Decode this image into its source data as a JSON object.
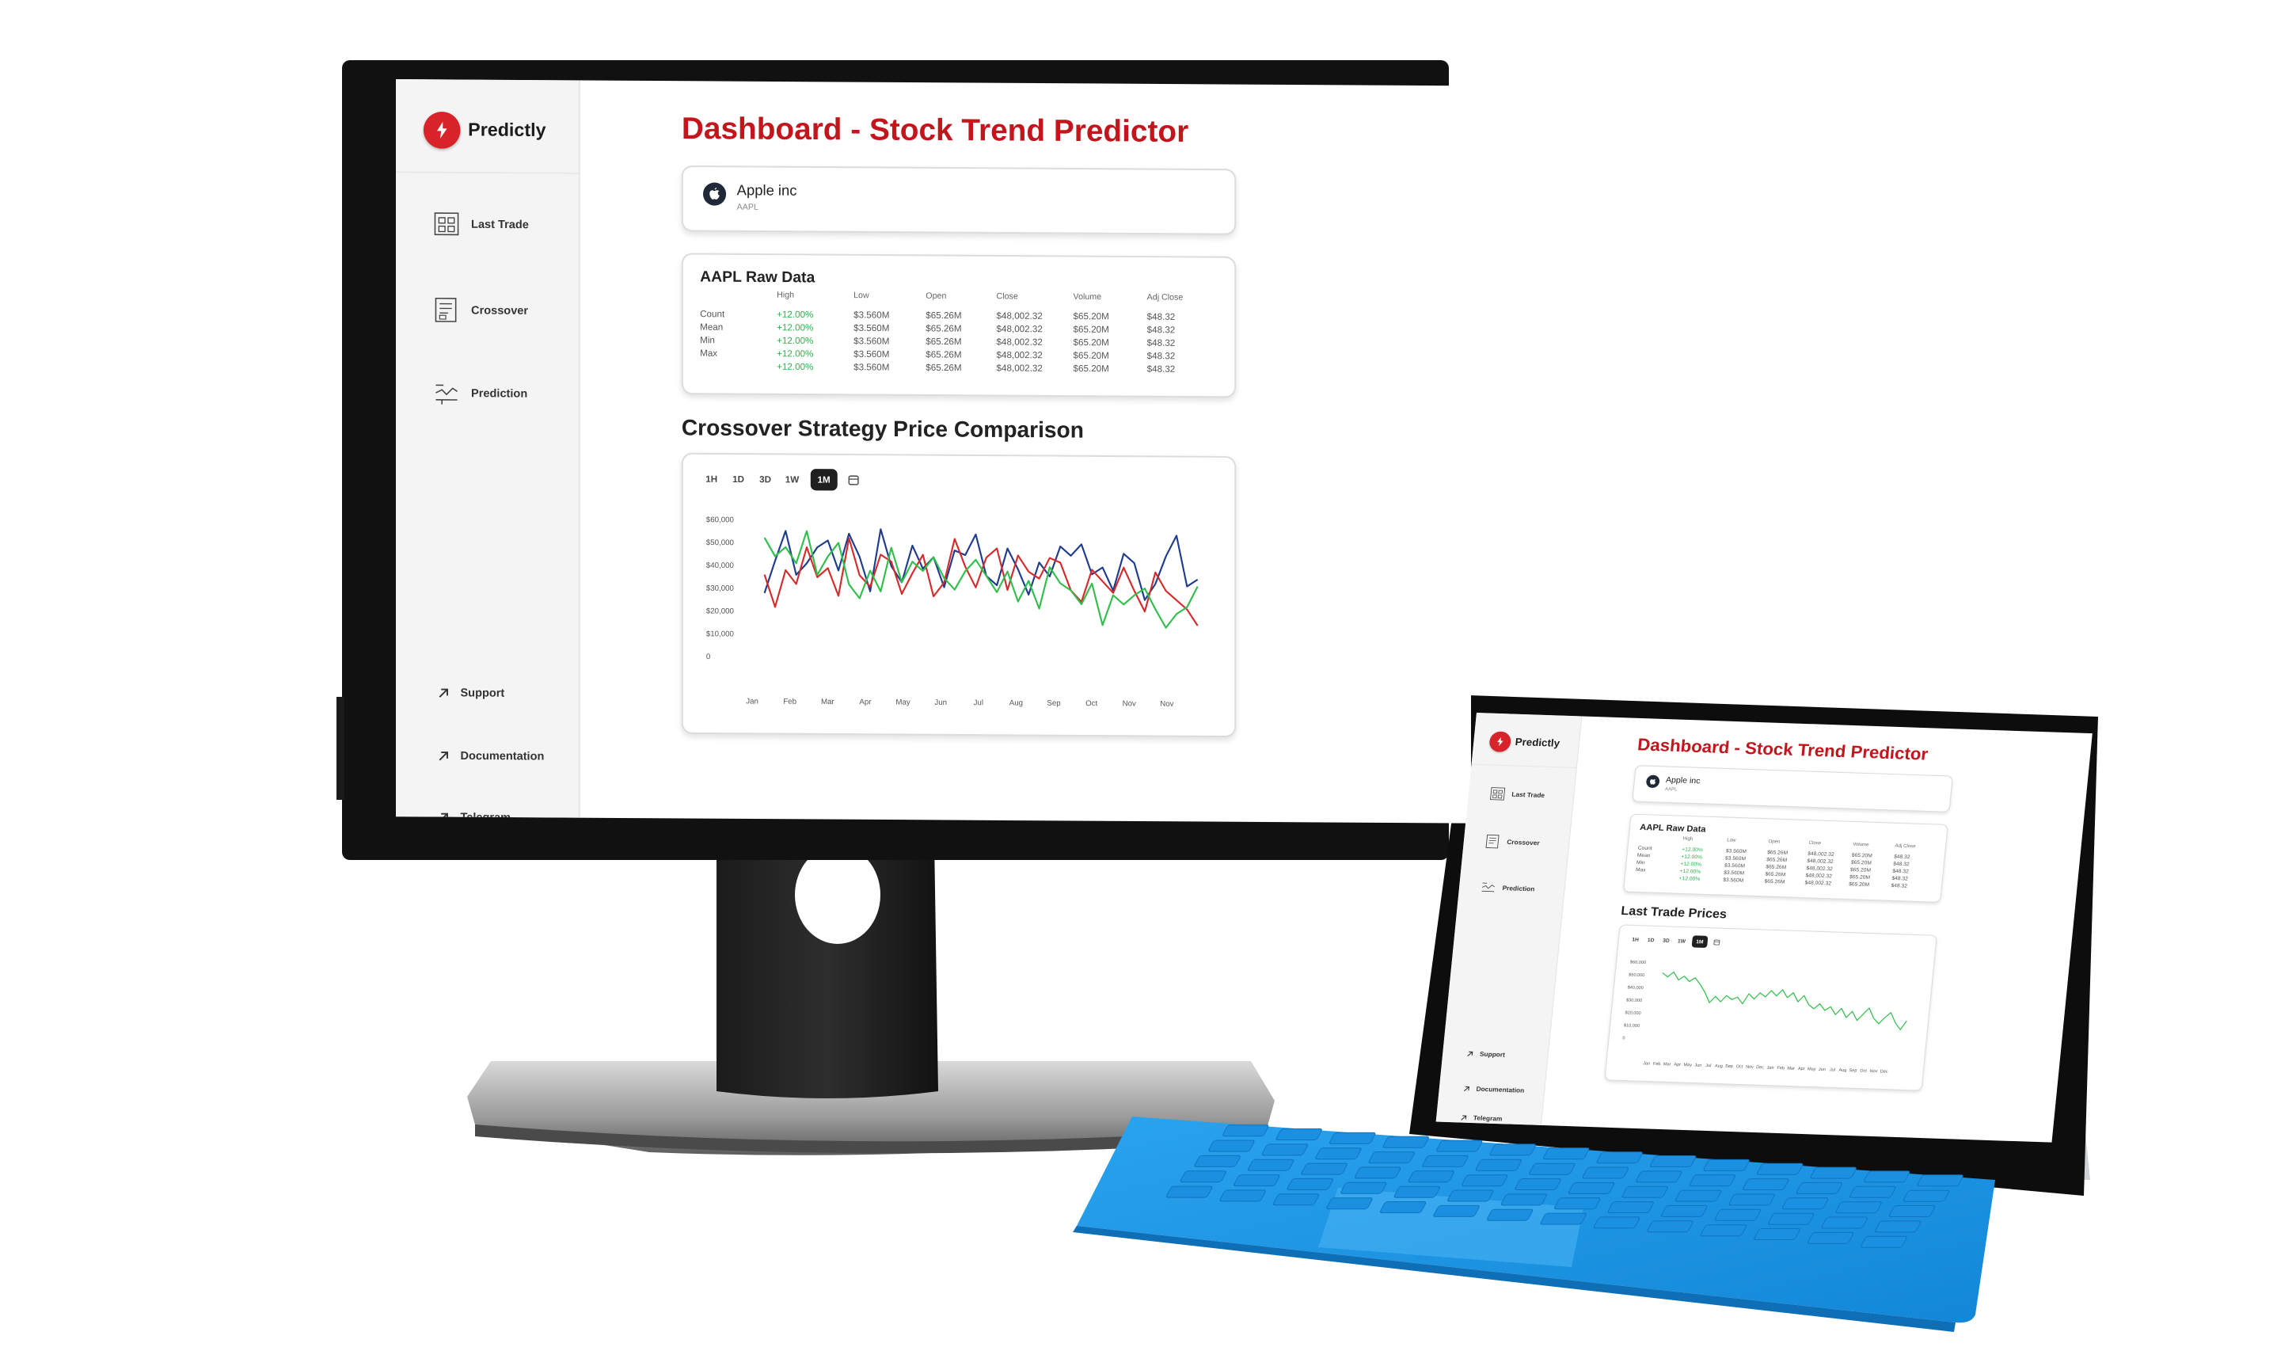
{
  "app": {
    "brand": "Predictly",
    "nav": [
      {
        "label": "Last Trade",
        "icon": "last-trade-icon"
      },
      {
        "label": "Crossover",
        "icon": "crossover-icon"
      },
      {
        "label": "Prediction",
        "icon": "prediction-icon"
      }
    ],
    "footer_links": [
      {
        "label": "Support",
        "icon": "arrow-up-right-icon"
      },
      {
        "label": "Documentation",
        "icon": "arrow-up-right-icon"
      },
      {
        "label": "Telegram",
        "icon": "arrow-up-right-icon"
      }
    ],
    "title": "Dashboard - Stock Trend Predictor",
    "company": {
      "name": "Apple inc",
      "ticker": "AAPL",
      "icon": "apple-icon"
    },
    "raw_data": {
      "title": "AAPL Raw Data",
      "columns": [
        "",
        "High",
        "Low",
        "Open",
        "Close",
        "Volume",
        "Adj Close"
      ],
      "rows": [
        [
          "Count",
          "+12.00%",
          "$3.560M",
          "$65.26M",
          "$48,002.32",
          "$65.20M",
          "$48.32"
        ],
        [
          "Mean",
          "+12.00%",
          "$3.560M",
          "$65.26M",
          "$48,002.32",
          "$65.20M",
          "$48.32"
        ],
        [
          "Min",
          "+12.00%",
          "$3.560M",
          "$65.26M",
          "$48,002.32",
          "$65.20M",
          "$48.32"
        ],
        [
          "Max",
          "+12.00%",
          "$3.560M",
          "$65.26M",
          "$48,002.32",
          "$65.20M",
          "$48.32"
        ],
        [
          "",
          "+12.00%",
          "$3.560M",
          "$65.26M",
          "$48,002.32",
          "$65.20M",
          "$48.32"
        ]
      ]
    },
    "ranges": [
      "1H",
      "1D",
      "3D",
      "1W",
      "1M"
    ],
    "active_range": "1M",
    "range_extra_icon": "calendar-icon",
    "colors": {
      "brand_red": "#d9232a",
      "title_red": "#c4141c",
      "positive": "#28b34c"
    }
  },
  "monitor": {
    "section_title": "Crossover Strategy Price Comparison"
  },
  "tablet": {
    "section_title": "Last Trade Prices"
  },
  "chart_data": [
    {
      "type": "line",
      "title": "Crossover Strategy Price Comparison",
      "categories": [
        "Jan",
        "Feb",
        "Mar",
        "Apr",
        "May",
        "Jun",
        "Jul",
        "Aug",
        "Sep",
        "Oct",
        "Nov",
        "Nov"
      ],
      "y_ticks": [
        "$60,000",
        "$50,000",
        "$40,000",
        "$30,000",
        "$20,000",
        "$10,000",
        "0"
      ],
      "ylim": [
        0,
        60000
      ],
      "grid": false,
      "series": [
        {
          "color": "#1f3b8f",
          "values": [
            28000,
            42000,
            55000,
            36000,
            41000,
            48000,
            51000,
            38000,
            54000,
            44000,
            29000,
            56000,
            40000,
            33000,
            49000,
            39000,
            44000,
            31000,
            47000,
            45000,
            54000,
            36000,
            32000,
            48000,
            39000,
            28000,
            42000,
            36000,
            49000,
            45000,
            50000,
            37000,
            40000,
            30000,
            46000,
            42000,
            26000,
            33000,
            45000,
            54000,
            32000,
            35000
          ]
        },
        {
          "color": "#d62a2a",
          "values": [
            36000,
            22000,
            38000,
            32000,
            48000,
            35000,
            39000,
            27000,
            52000,
            36000,
            31000,
            45000,
            42000,
            28000,
            37000,
            45000,
            27000,
            33000,
            52000,
            40000,
            31000,
            44000,
            48000,
            30000,
            45000,
            38000,
            35000,
            44000,
            42000,
            30000,
            25000,
            39000,
            34000,
            29000,
            40000,
            30000,
            21000,
            38000,
            30000,
            26000,
            22000,
            15000
          ]
        },
        {
          "color": "#2fbf4a",
          "values": [
            52000,
            44000,
            48000,
            41000,
            55000,
            36000,
            44000,
            50000,
            32000,
            26000,
            38000,
            29000,
            48000,
            33000,
            42000,
            38000,
            44000,
            35000,
            30000,
            38000,
            43000,
            36000,
            29000,
            38000,
            25000,
            34000,
            22000,
            40000,
            33000,
            30000,
            24000,
            33000,
            15000,
            28000,
            24000,
            28000,
            31000,
            22000,
            14000,
            20000,
            23000,
            32000
          ]
        }
      ]
    },
    {
      "type": "line",
      "title": "Last Trade Prices",
      "categories": [
        "Jan",
        "Feb",
        "Mar",
        "Apr",
        "May",
        "Jun",
        "Jul",
        "Aug",
        "Sep",
        "Oct",
        "Nov",
        "Dec",
        "Jan",
        "Feb",
        "Mar",
        "Apr",
        "May",
        "Jun",
        "Jul",
        "Aug",
        "Sep",
        "Oct",
        "Nov",
        "Dec"
      ],
      "y_ticks": [
        "$60,000",
        "$50,000",
        "$40,000",
        "$30,000",
        "$20,000",
        "$10,000",
        "0"
      ],
      "ylim": [
        0,
        60000
      ],
      "grid": false,
      "series": [
        {
          "color": "#2fbf4a",
          "values": [
            52000,
            49000,
            53000,
            47000,
            50000,
            46000,
            49000,
            44000,
            38000,
            30000,
            35000,
            31000,
            36000,
            33000,
            35000,
            30000,
            38000,
            34000,
            39000,
            36000,
            41000,
            37000,
            42000,
            36000,
            40000,
            33000,
            38000,
            31000,
            28000,
            32000,
            27000,
            30000,
            24000,
            29000,
            22000,
            27000,
            20000,
            25000,
            30000,
            22000,
            18000,
            23000,
            27000,
            19000,
            14000,
            21000
          ]
        }
      ]
    }
  ]
}
